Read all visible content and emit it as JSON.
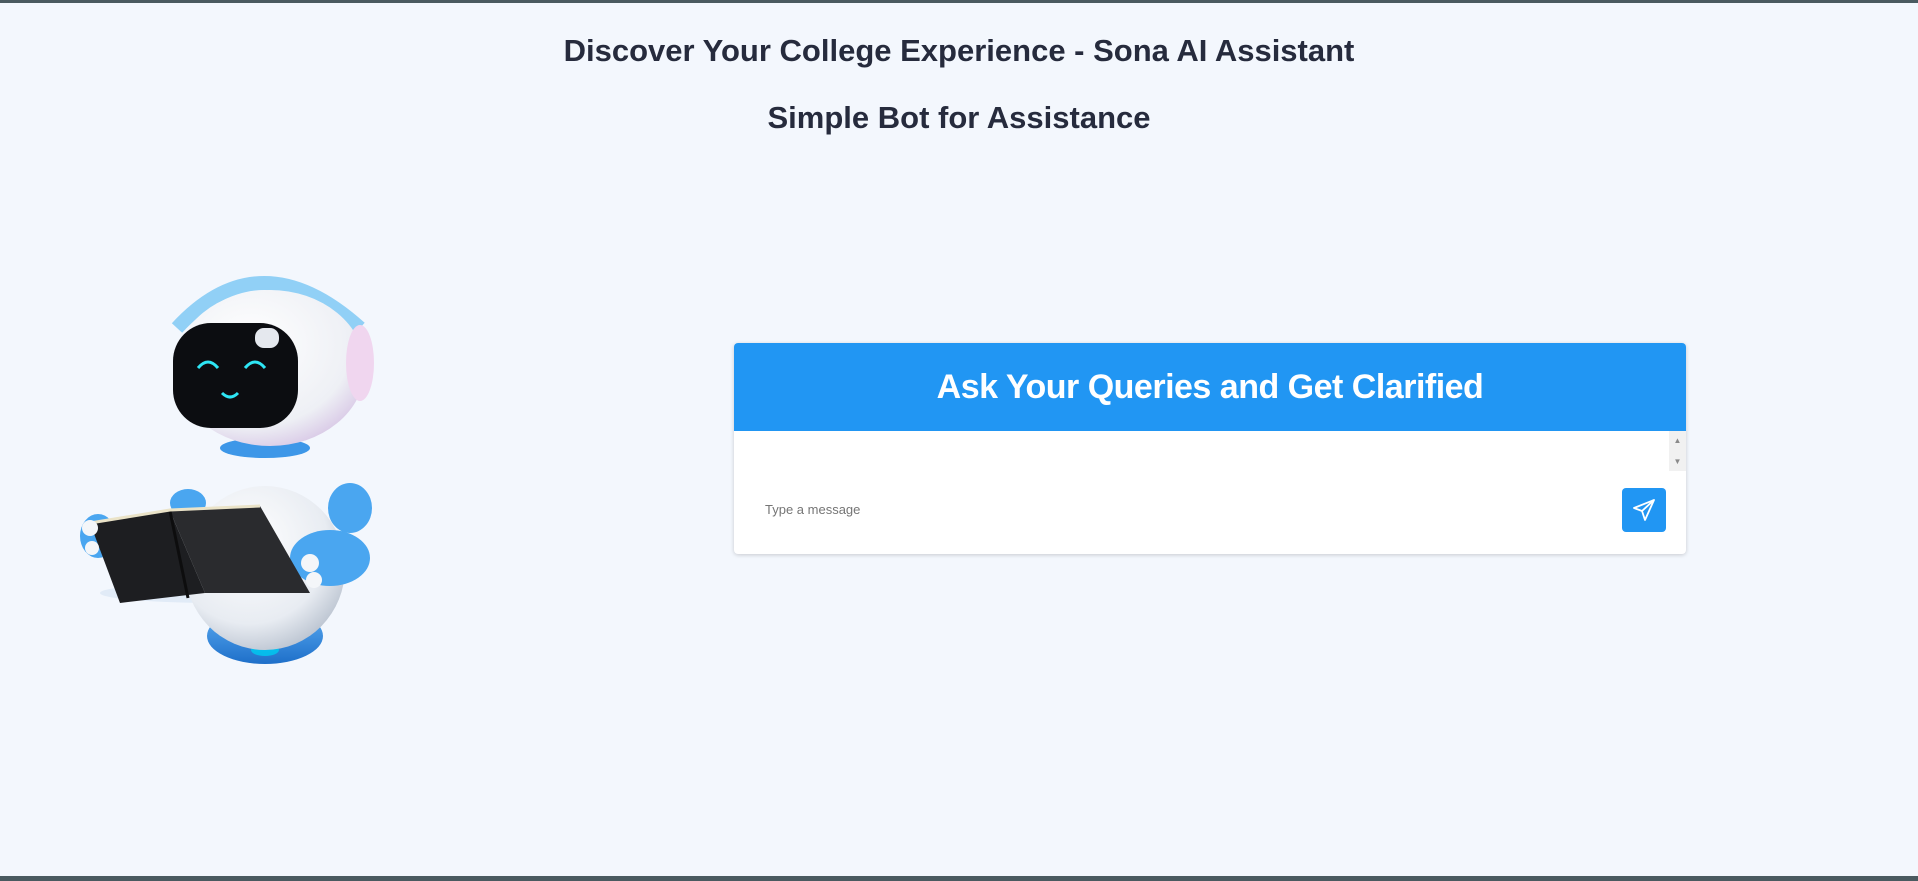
{
  "header": {
    "title": "Discover Your College Experience - Sona AI Assistant",
    "subtitle": "Simple Bot for Assistance"
  },
  "illustration": {
    "icon": "robot-reading-book-icon"
  },
  "chat": {
    "title": "Ask Your Queries and Get Clarified",
    "messages": [],
    "input": {
      "placeholder": "Type a message",
      "value": ""
    },
    "send_icon": "paper-plane-icon"
  },
  "colors": {
    "accent": "#2196f3",
    "background": "#f3f7fd",
    "heading": "#262b3d",
    "frame": "#4a5a60"
  }
}
